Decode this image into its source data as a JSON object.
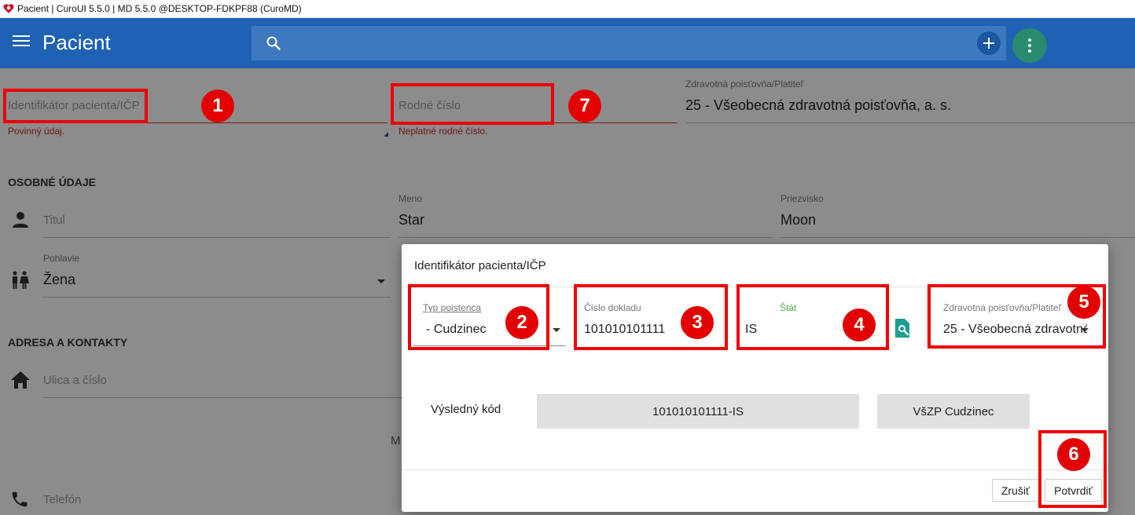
{
  "window": {
    "title": "Pacient | CuroUI 5.5.0 | MD 5.5.0 @DESKTOP-FDKPF88 (CuroMD)"
  },
  "appbar": {
    "title": "Pacient",
    "search_placeholder": ""
  },
  "form": {
    "icp": {
      "label": "Identifikátor pacienta/IČP",
      "error": "Povinný údaj."
    },
    "rodne_cislo": {
      "label": "Rodné číslo",
      "error": "Neplatné rodné číslo."
    },
    "poistovna": {
      "label": "Zdravotná poisťovňa/Platiteľ",
      "value": "25 - Všeobecná zdravotná poisťovňa, a. s."
    },
    "section_personal": "OSOBNÉ ÚDAJE",
    "titul": {
      "label": "Titul"
    },
    "meno": {
      "label": "Meno",
      "value": "Star"
    },
    "priezvisko": {
      "label": "Priezvisko",
      "value": "Moon"
    },
    "pohlavie": {
      "label": "Pohlavie",
      "value": "Žena"
    },
    "section_address": "ADRESA A KONTAKTY",
    "ulica": {
      "label": "Ulica a číslo"
    },
    "telefon": {
      "label": "Telefón"
    },
    "partial_m": "M"
  },
  "dialog": {
    "title": "Identifikátor pacienta/IČP",
    "typ_poistenca": {
      "label": "Typ poistenca",
      "value": "- Cudzinec"
    },
    "cislo_dokladu": {
      "label": "Číslo dokladu",
      "value": "101010101111"
    },
    "stat": {
      "label": "Štát",
      "value": "IS"
    },
    "poistovna": {
      "label": "Zdravotná poisťovňa/Platiteľ",
      "value": "25 - Všeobecná zdravotná"
    },
    "result_label": "Výsledný kód",
    "result_code": "101010101111-IS",
    "result_type": "VšZP Cudzinec",
    "cancel_label": "Zrušiť",
    "confirm_label": "Potvrdiť"
  },
  "annotations": [
    "1",
    "2",
    "3",
    "4",
    "5",
    "6",
    "7"
  ],
  "colors": {
    "appbar": "#1f62b4",
    "search": "#3e79c0",
    "fab_more": "#2a8a6e",
    "highlight": "#ee0000",
    "error": "#c62828",
    "stat_label": "#4caf50",
    "lookup_icon": "#1e9e8e"
  }
}
